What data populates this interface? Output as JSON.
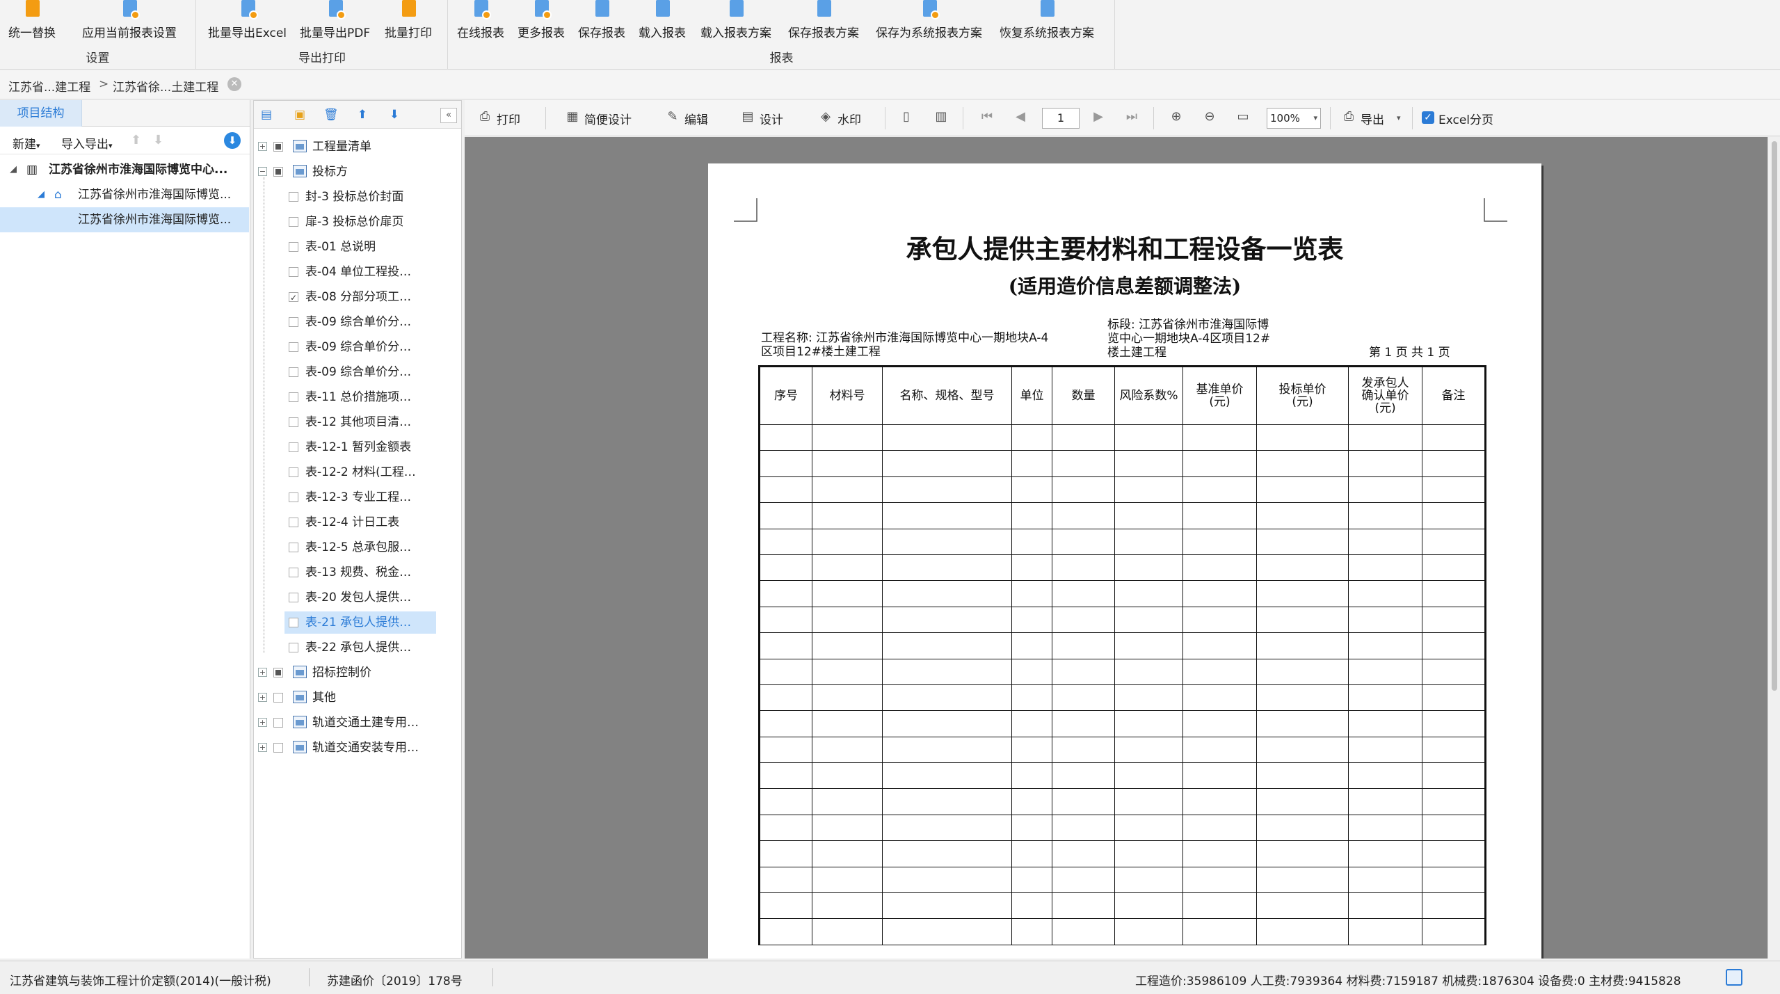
{
  "ribbon": {
    "groups": [
      {
        "name": "设置",
        "buttons": [
          "统一替换",
          "应用当前报表设置"
        ]
      },
      {
        "name": "导出打印",
        "buttons": [
          "批量导出Excel",
          "批量导出PDF",
          "批量打印"
        ]
      },
      {
        "name": "报表",
        "buttons": [
          "在线报表",
          "更多报表",
          "保存报表",
          "载入报表",
          "载入报表方案",
          "保存报表方案",
          "保存为系统报表方案",
          "恢复系统报表方案"
        ]
      }
    ]
  },
  "breadcrumb": {
    "items": [
      "江苏省...建工程",
      "江苏省徐...土建工程"
    ],
    "separator": ">"
  },
  "left_panel": {
    "tab": "项目结构",
    "tools": {
      "new": "新建",
      "import_export": "导入导出"
    },
    "tree": [
      "江苏省徐州市淮海国际博览中心...",
      "江苏省徐州市淮海国际博览...",
      "江苏省徐州市淮海国际博览..."
    ]
  },
  "report_tree": {
    "nodes": [
      {
        "label": "工程量清单",
        "expand": "+"
      },
      {
        "label": "投标方",
        "expand": "−"
      },
      {
        "label": "封-3 投标总价封面"
      },
      {
        "label": "扉-3 投标总价扉页"
      },
      {
        "label": "表-01 总说明"
      },
      {
        "label": "表-04 单位工程投…"
      },
      {
        "label": "表-08 分部分项工…"
      },
      {
        "label": "表-09 综合单价分…"
      },
      {
        "label": "表-09 综合单价分…"
      },
      {
        "label": "表-09 综合单价分…"
      },
      {
        "label": "表-11 总价措施项…"
      },
      {
        "label": "表-12 其他项目清…"
      },
      {
        "label": "表-12-1 暂列金额表"
      },
      {
        "label": "表-12-2 材料(工程…"
      },
      {
        "label": "表-12-3 专业工程…"
      },
      {
        "label": "表-12-4 计日工表"
      },
      {
        "label": "表-12-5 总承包服…"
      },
      {
        "label": "表-13 规费、税金…"
      },
      {
        "label": "表-20 发包人提供…"
      },
      {
        "label": "表-21 承包人提供…"
      },
      {
        "label": "表-22 承包人提供…"
      },
      {
        "label": "招标控制价",
        "expand": "+"
      },
      {
        "label": "其他",
        "expand": "+"
      },
      {
        "label": "轨道交通土建专用…",
        "expand": "+"
      },
      {
        "label": "轨道交通安装专用…",
        "expand": "+"
      }
    ]
  },
  "preview_toolbar": {
    "print": "打印",
    "simple_design": "简便设计",
    "edit": "编辑",
    "design": "设计",
    "watermark": "水印",
    "page": "1",
    "zoom": "100%",
    "export": "导出",
    "excel_paging": "Excel分页"
  },
  "document": {
    "title": "承包人提供主要材料和工程设备一览表",
    "subtitle": "(适用造价信息差额调整法)",
    "project_label": "工程名称: 江苏省徐州市淮海国际博览中心一期地块A-4",
    "project_label_2": "区项目12#楼土建工程",
    "section_label": "标段: 江苏省徐州市淮海国际博",
    "section_label_2": "览中心一期地块A-4区项目12#",
    "section_label_3": "楼土建工程",
    "page_info": "第 1 页  共 1 页",
    "columns": [
      "序号",
      "材料号",
      "名称、规格、型号",
      "单位",
      "数量",
      "风险系数%",
      "基准单价\n(元)",
      "投标单价\n(元)",
      "发承包人\n确认单价\n(元)",
      "备注"
    ],
    "empty_rows": 20
  },
  "status_bar": {
    "quota": "江苏省建筑与装饰工程计价定额(2014)(一般计税)",
    "doc": "苏建函价〔2019〕178号",
    "summary": "工程造价:35986109  人工费:7939364  材料费:7159187  机械费:1876304  设备费:0  主材费:9415828"
  },
  "colors": {
    "accent": "#2b7bd6",
    "canvas": "#828282",
    "selection": "#cfe5fb"
  }
}
